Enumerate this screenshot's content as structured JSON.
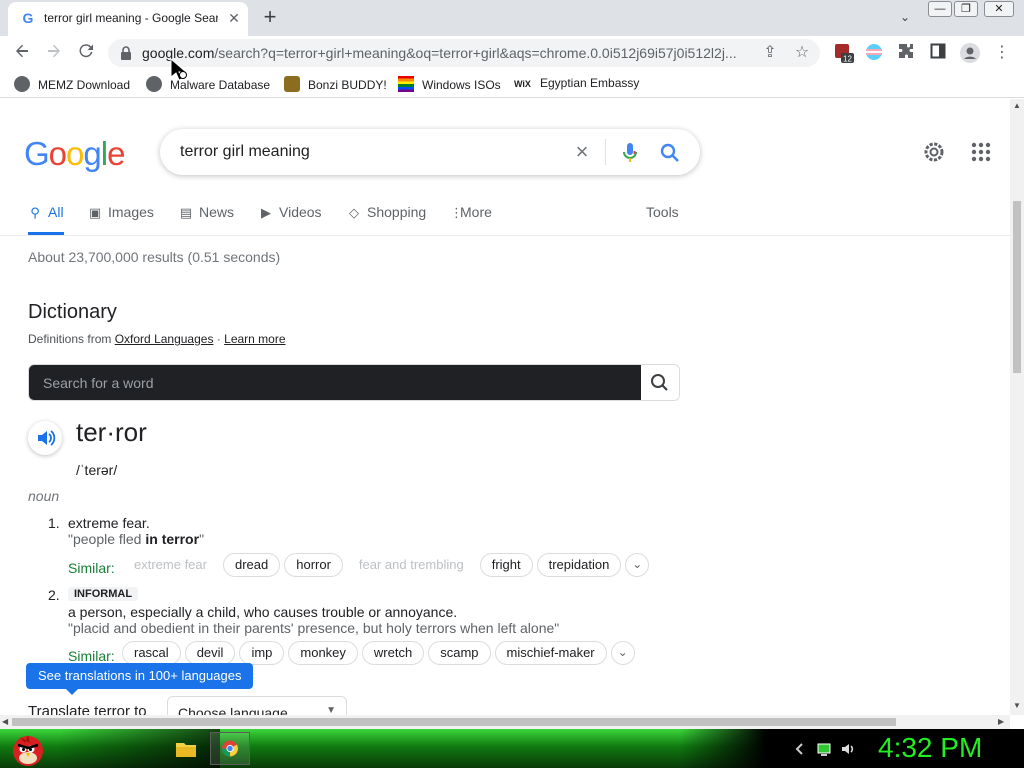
{
  "browser": {
    "tab_title": "terror girl meaning - Google Search",
    "new_tab": "+",
    "url_domain": "google.com",
    "url_rest": "/search?q=terror+girl+meaning&oq=terror+girl&aqs=chrome.0.0i512j69i57j0i512l2j...",
    "extension_badge": "12",
    "window_controls": {
      "minimize": "—",
      "restore": "❐",
      "close": "✕"
    }
  },
  "bookmarks": [
    {
      "label": "MEMZ Download",
      "icon": "globe-icon",
      "color": "#5f6368"
    },
    {
      "label": "Malware Database",
      "icon": "globe-icon",
      "color": "#5f6368"
    },
    {
      "label": "Bonzi BUDDY!",
      "icon": "bonzi-icon",
      "color": "#8a6d1e"
    },
    {
      "label": "Windows ISOs",
      "icon": "rainbow-flag-icon",
      "color": "#e40303"
    },
    {
      "label": "Egyptian Embassy",
      "icon": "wix-icon",
      "color": "#000000"
    }
  ],
  "search": {
    "query": "terror girl meaning",
    "logo": "Google"
  },
  "tabs": [
    {
      "label": "All",
      "icon": "search-icon",
      "active": true
    },
    {
      "label": "Images",
      "icon": "image-icon"
    },
    {
      "label": "News",
      "icon": "news-icon"
    },
    {
      "label": "Videos",
      "icon": "video-icon"
    },
    {
      "label": "Shopping",
      "icon": "tag-icon"
    },
    {
      "label": "More",
      "icon": "more-vert-icon"
    },
    {
      "label": "Tools"
    }
  ],
  "results_stats": "About 23,700,000 results (0.51 seconds)",
  "dictionary": {
    "title": "Dictionary",
    "source_prefix": "Definitions from",
    "source_link": "Oxford Languages",
    "separator": "·",
    "learn_more": "Learn more",
    "search_placeholder": "Search for a word",
    "headword": "ter·ror",
    "phonetic": "/ˈterər/",
    "part_of_speech": "noun",
    "similar_label": "Similar:",
    "definitions": [
      {
        "number": "1.",
        "text": "extreme fear.",
        "example_pre": "\"people fled ",
        "example_bold": "in terror",
        "example_post": "\"",
        "similar": [
          "extreme fear",
          "dread",
          "horror",
          "fear and trembling",
          "fright",
          "trepidation"
        ],
        "faded": [
          0,
          3
        ]
      },
      {
        "number": "2.",
        "label": "INFORMAL",
        "text": "a person, especially a child, who causes trouble or annoyance.",
        "example": "\"placid and obedient in their parents' presence, but holy terrors when left alone\"",
        "similar": [
          "rascal",
          "devil",
          "imp",
          "monkey",
          "wretch",
          "scamp",
          "mischief-maker"
        ]
      }
    ],
    "translate_button": "See translations in 100+ languages",
    "translate_label": "Translate terror to",
    "language_select": "Choose language"
  },
  "taskbar": {
    "clock": "4:32 PM"
  }
}
